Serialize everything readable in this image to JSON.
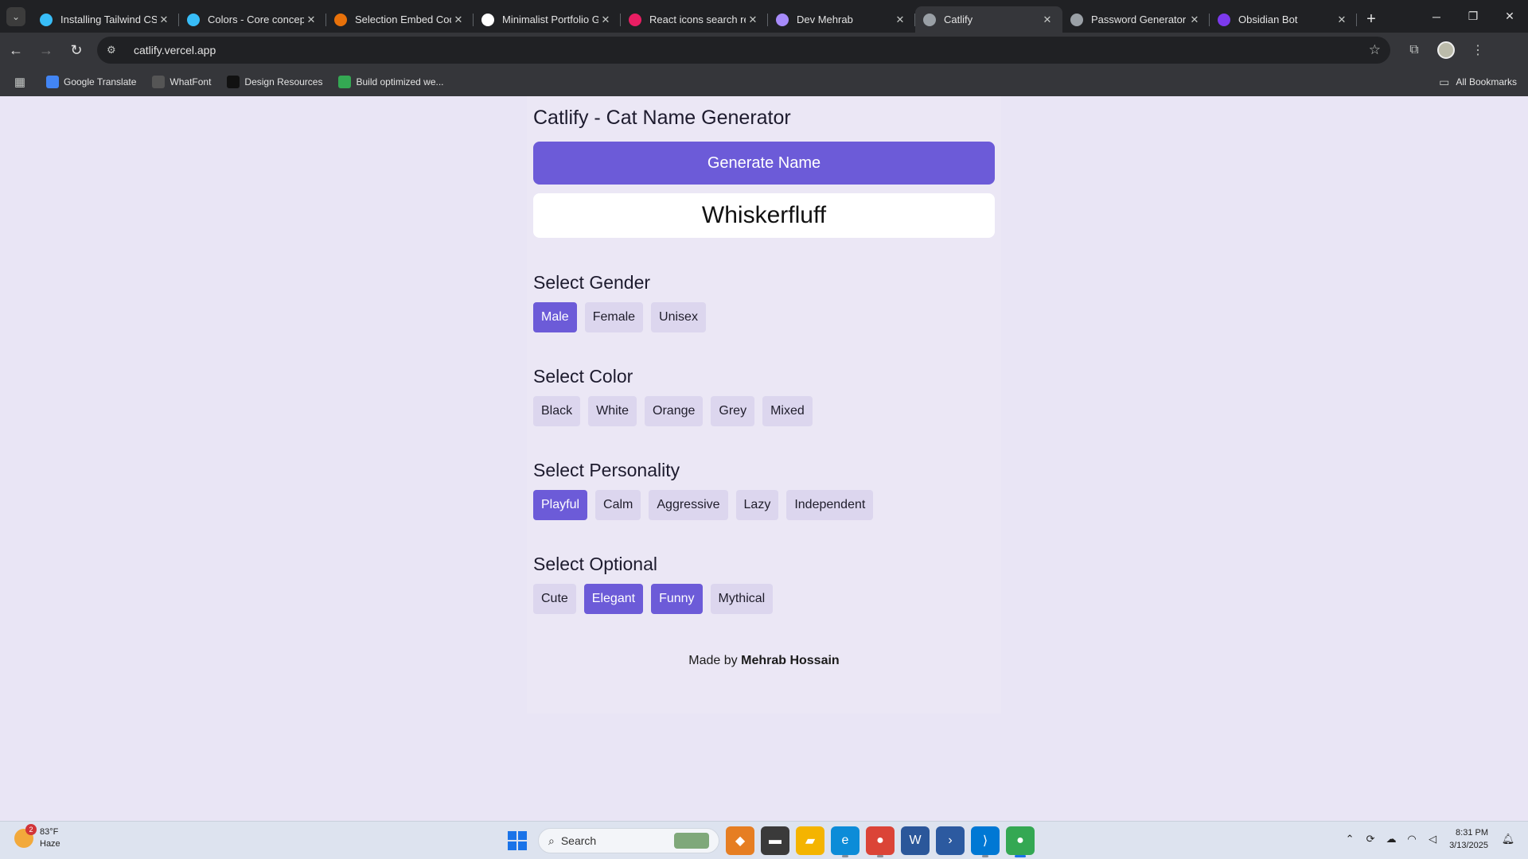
{
  "browser": {
    "tabs": [
      {
        "title": "Installing Tailwind CSS",
        "favicon": "tailwind-icon",
        "color": "#38bdf8"
      },
      {
        "title": "Colors - Core concepts",
        "favicon": "tailwind-icon",
        "color": "#38bdf8"
      },
      {
        "title": "Selection Embed Code",
        "favicon": "google-fonts-icon",
        "color": "#e8710a"
      },
      {
        "title": "Minimalist Portfolio Generator",
        "favicon": "github-icon",
        "color": "#ffffff"
      },
      {
        "title": "React icons search results",
        "favicon": "react-icons-icon",
        "color": "#e91e63"
      },
      {
        "title": "Dev Mehrab",
        "favicon": "vercel-icon",
        "color": "#a78bfa"
      },
      {
        "title": "Catlify",
        "favicon": "globe-icon",
        "color": "#9aa0a6"
      },
      {
        "title": "Password Generator",
        "favicon": "globe-icon",
        "color": "#9aa0a6"
      },
      {
        "title": "Obsidian Bot",
        "favicon": "obsidian-icon",
        "color": "#7c3aed"
      }
    ],
    "url": "catlify.vercel.app",
    "bookmarks": [
      {
        "label": "Google Translate",
        "icon": "translate-icon",
        "color": "#4285f4"
      },
      {
        "label": "WhatFont",
        "icon": "whatfont-icon",
        "color": "#555555"
      },
      {
        "label": "Design Resources",
        "icon": "design-icon",
        "color": "#111111"
      },
      {
        "label": "Build optimized we...",
        "icon": "sheet-icon",
        "color": "#34a853"
      }
    ],
    "all_bookmarks": "All Bookmarks"
  },
  "app": {
    "title": "Catlify - Cat Name Generator",
    "generate_label": "Generate Name",
    "generated_name": "Whiskerfluff",
    "accent": "#6c5bd8",
    "sections": [
      {
        "title": "Select Gender",
        "options": [
          {
            "label": "Male",
            "selected": true
          },
          {
            "label": "Female",
            "selected": false
          },
          {
            "label": "Unisex",
            "selected": false
          }
        ]
      },
      {
        "title": "Select Color",
        "options": [
          {
            "label": "Black",
            "selected": false
          },
          {
            "label": "White",
            "selected": false
          },
          {
            "label": "Orange",
            "selected": false
          },
          {
            "label": "Grey",
            "selected": false
          },
          {
            "label": "Mixed",
            "selected": false
          }
        ]
      },
      {
        "title": "Select Personality",
        "options": [
          {
            "label": "Playful",
            "selected": true
          },
          {
            "label": "Calm",
            "selected": false
          },
          {
            "label": "Aggressive",
            "selected": false
          },
          {
            "label": "Lazy",
            "selected": false
          },
          {
            "label": "Independent",
            "selected": false
          }
        ]
      },
      {
        "title": "Select Optional",
        "options": [
          {
            "label": "Cute",
            "selected": false
          },
          {
            "label": "Elegant",
            "selected": true
          },
          {
            "label": "Funny",
            "selected": true
          },
          {
            "label": "Mythical",
            "selected": false
          }
        ]
      }
    ],
    "footer": {
      "prefix": "Made by",
      "author": "Mehrab Hossain"
    }
  },
  "taskbar": {
    "weather": {
      "temp": "83°F",
      "condition": "Haze",
      "badge": "2"
    },
    "search_label": "Search",
    "time": "8:31 PM",
    "date": "3/13/2025"
  }
}
